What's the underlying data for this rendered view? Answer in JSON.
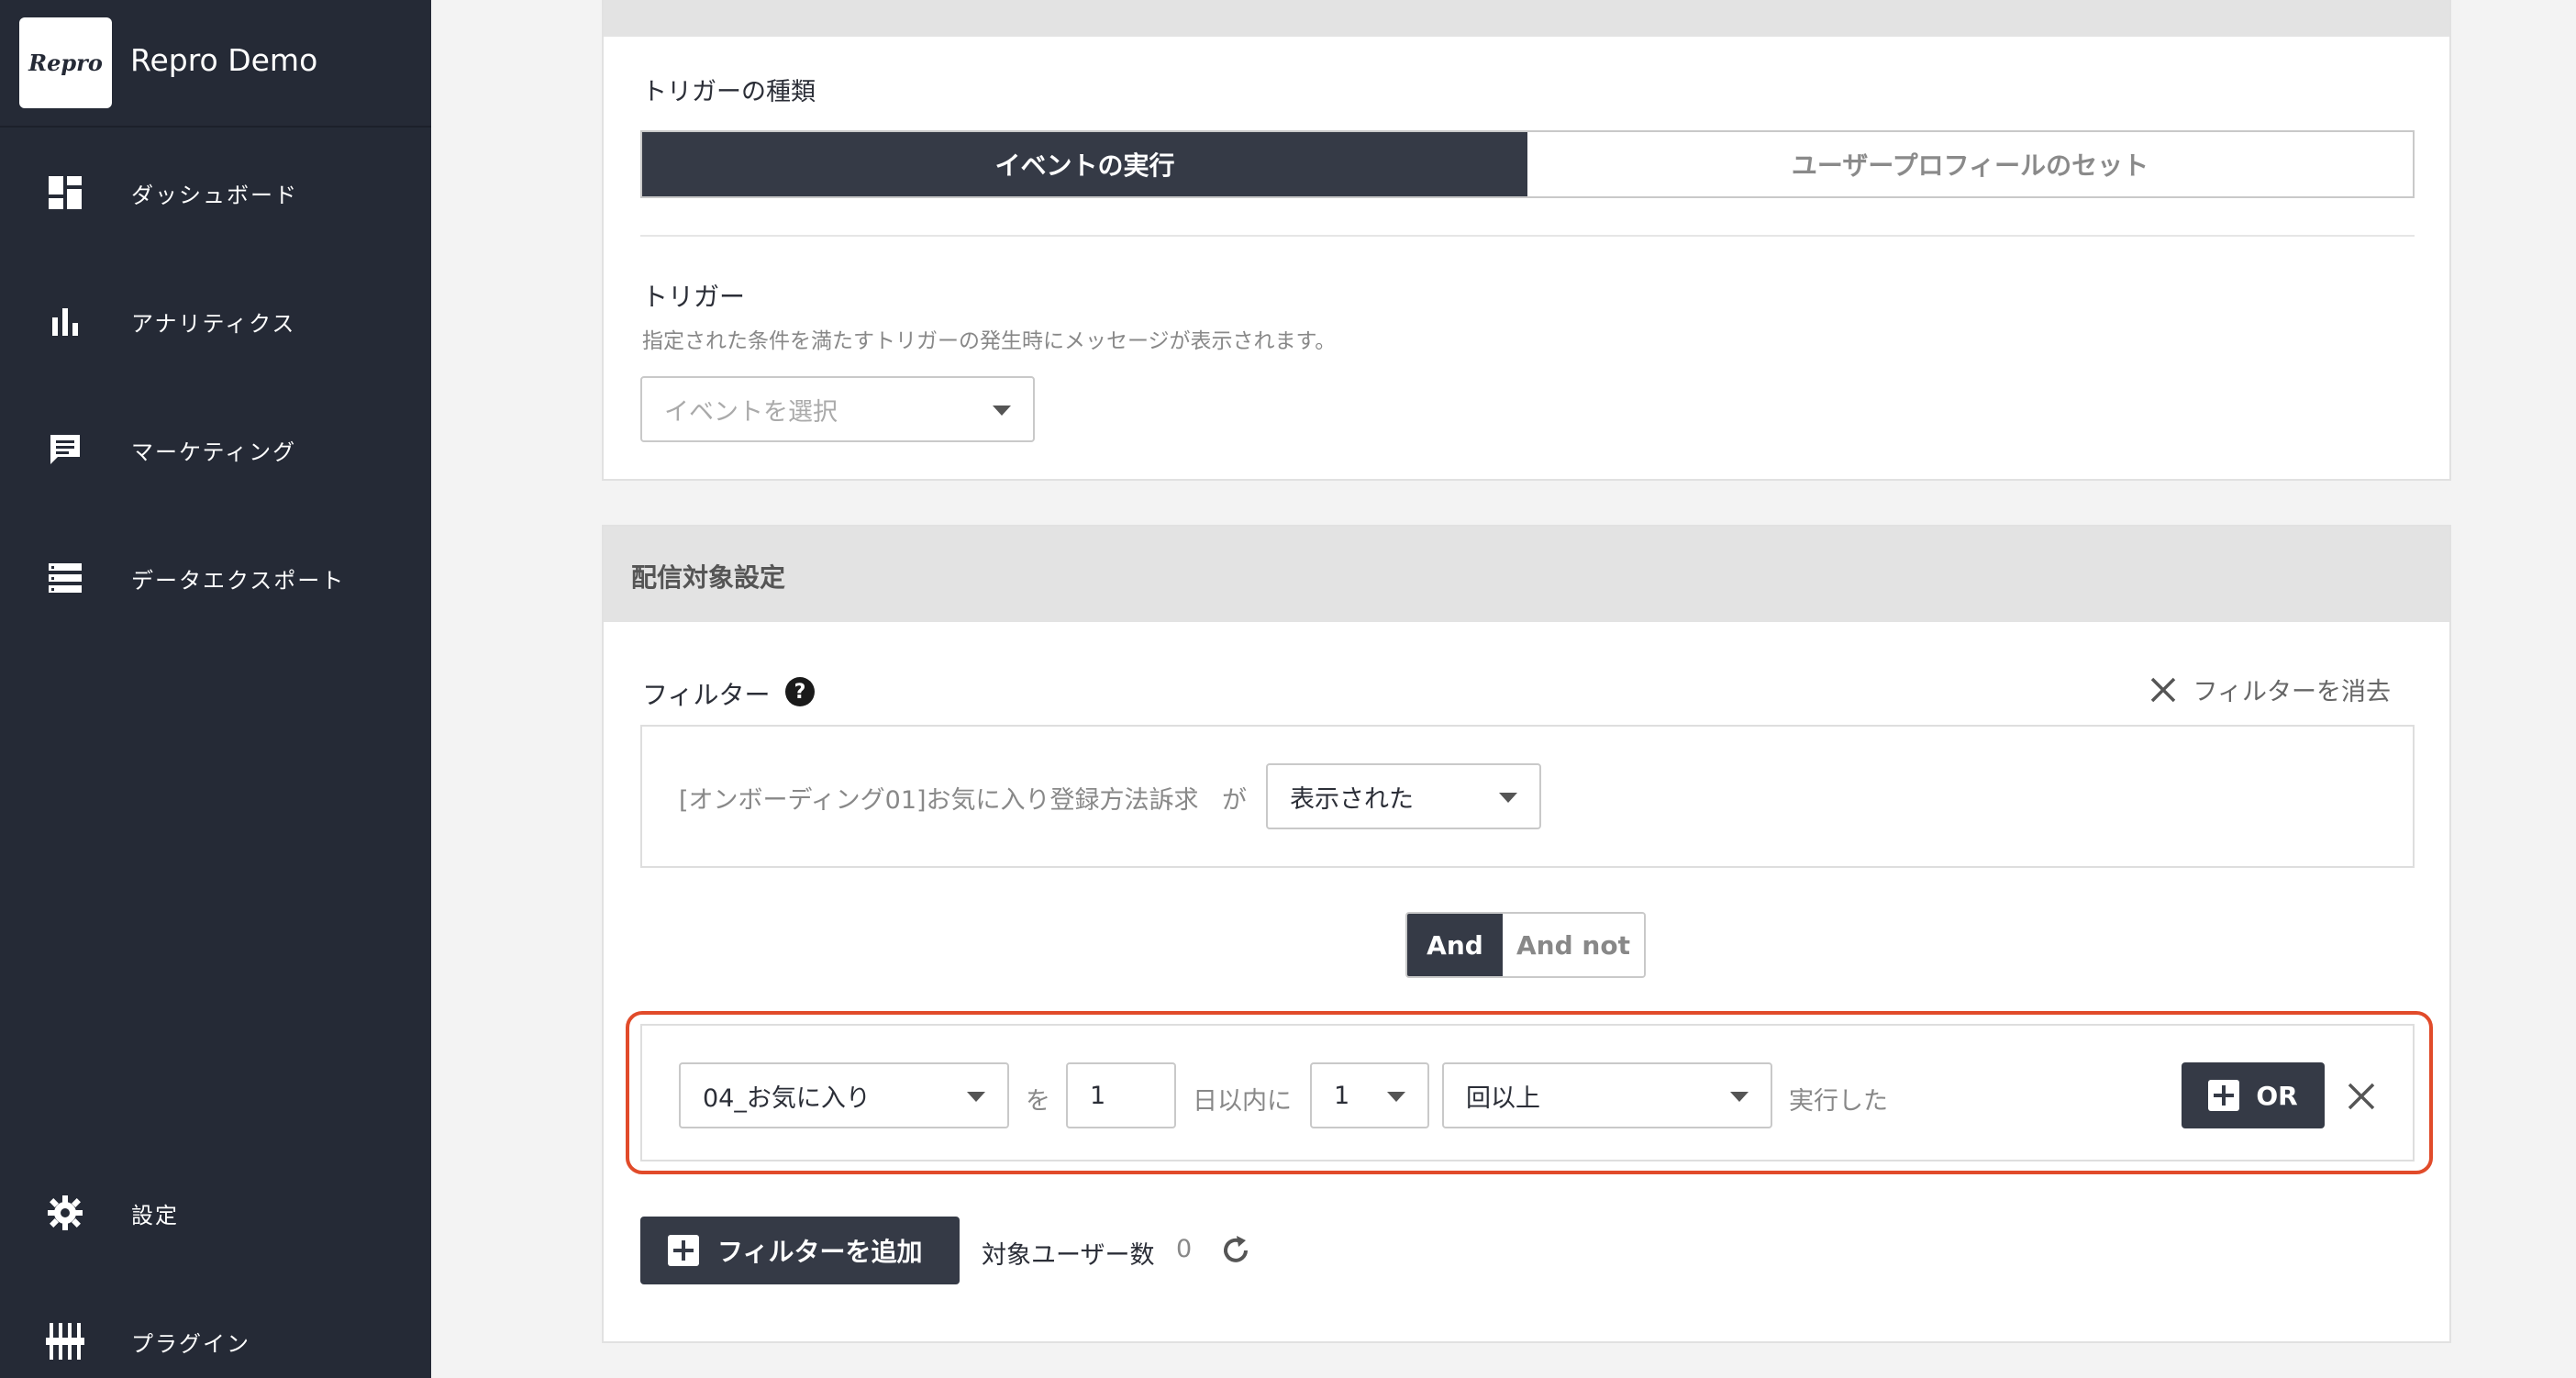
{
  "app": {
    "logo_text": "Repro",
    "name": "Repro Demo"
  },
  "sidebar": {
    "items": [
      {
        "label": "ダッシュボード",
        "icon": "dashboard-icon"
      },
      {
        "label": "アナリティクス",
        "icon": "analytics-icon"
      },
      {
        "label": "マーケティング",
        "icon": "chat-icon"
      },
      {
        "label": "データエクスポート",
        "icon": "list-icon"
      },
      {
        "label": "設定",
        "icon": "gear-icon"
      },
      {
        "label": "プラグイン",
        "icon": "plugin-icon"
      }
    ]
  },
  "trigger_section": {
    "type_label": "トリガーの種類",
    "type_options": [
      "イベントの実行",
      "ユーザープロフィールのセット"
    ],
    "type_selected": "イベントの実行",
    "trigger_label": "トリガー",
    "trigger_help": "指定された条件を満たすトリガーの発生時にメッセージが表示されます。",
    "event_placeholder": "イベントを選択"
  },
  "target_section": {
    "title": "配信対象設定",
    "filter_label": "フィルター",
    "clear_filter_label": "フィルターを消去",
    "message_filter": {
      "message_name": "[オンボーディング01]お気に入り登録方法訴求",
      "particle": "が",
      "status_value": "表示された"
    },
    "logic": {
      "and_label": "And",
      "and_not_label": "And not",
      "selected": "And"
    },
    "event_condition": {
      "event_value": "04_お気に入り",
      "particle": "を",
      "days_value": "1",
      "days_suffix": "日以内に",
      "count_value": "1",
      "count_mode": "回以上",
      "suffix": "実行した",
      "or_label": "OR"
    },
    "add_filter_label": "フィルターを追加",
    "target_users_label": "対象ユーザー数",
    "target_users_count": "0"
  }
}
